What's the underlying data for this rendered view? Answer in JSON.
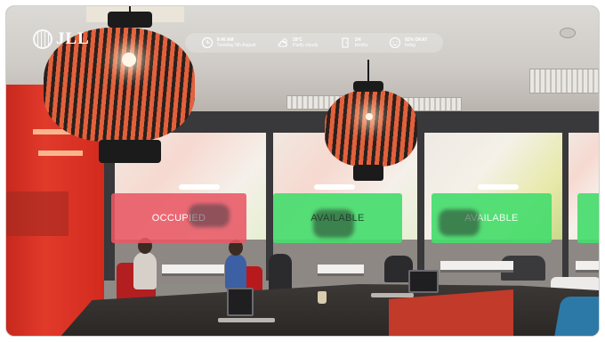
{
  "logo": {
    "text": "JLL"
  },
  "infobar": {
    "items": [
      {
        "icon": "clock-icon",
        "line1": "9:46 AM",
        "line2": "Tuesday 9th August"
      },
      {
        "icon": "cloud-sun-icon",
        "line1": "28°C",
        "line2": "Partly cloudy"
      },
      {
        "icon": "door-icon",
        "line1": "3/4",
        "line2": "booths"
      },
      {
        "icon": "smiley-icon",
        "line1": "92% OKAY",
        "line2": "today"
      }
    ]
  },
  "signs": {
    "occupied": "OCCUPIED",
    "available_1": "AVAILABLE",
    "available_2": "AVAILABLE",
    "available_3": ""
  },
  "colors": {
    "occupied": "#e85864",
    "available": "#46dc6e",
    "accent_red": "#d32a1e"
  }
}
